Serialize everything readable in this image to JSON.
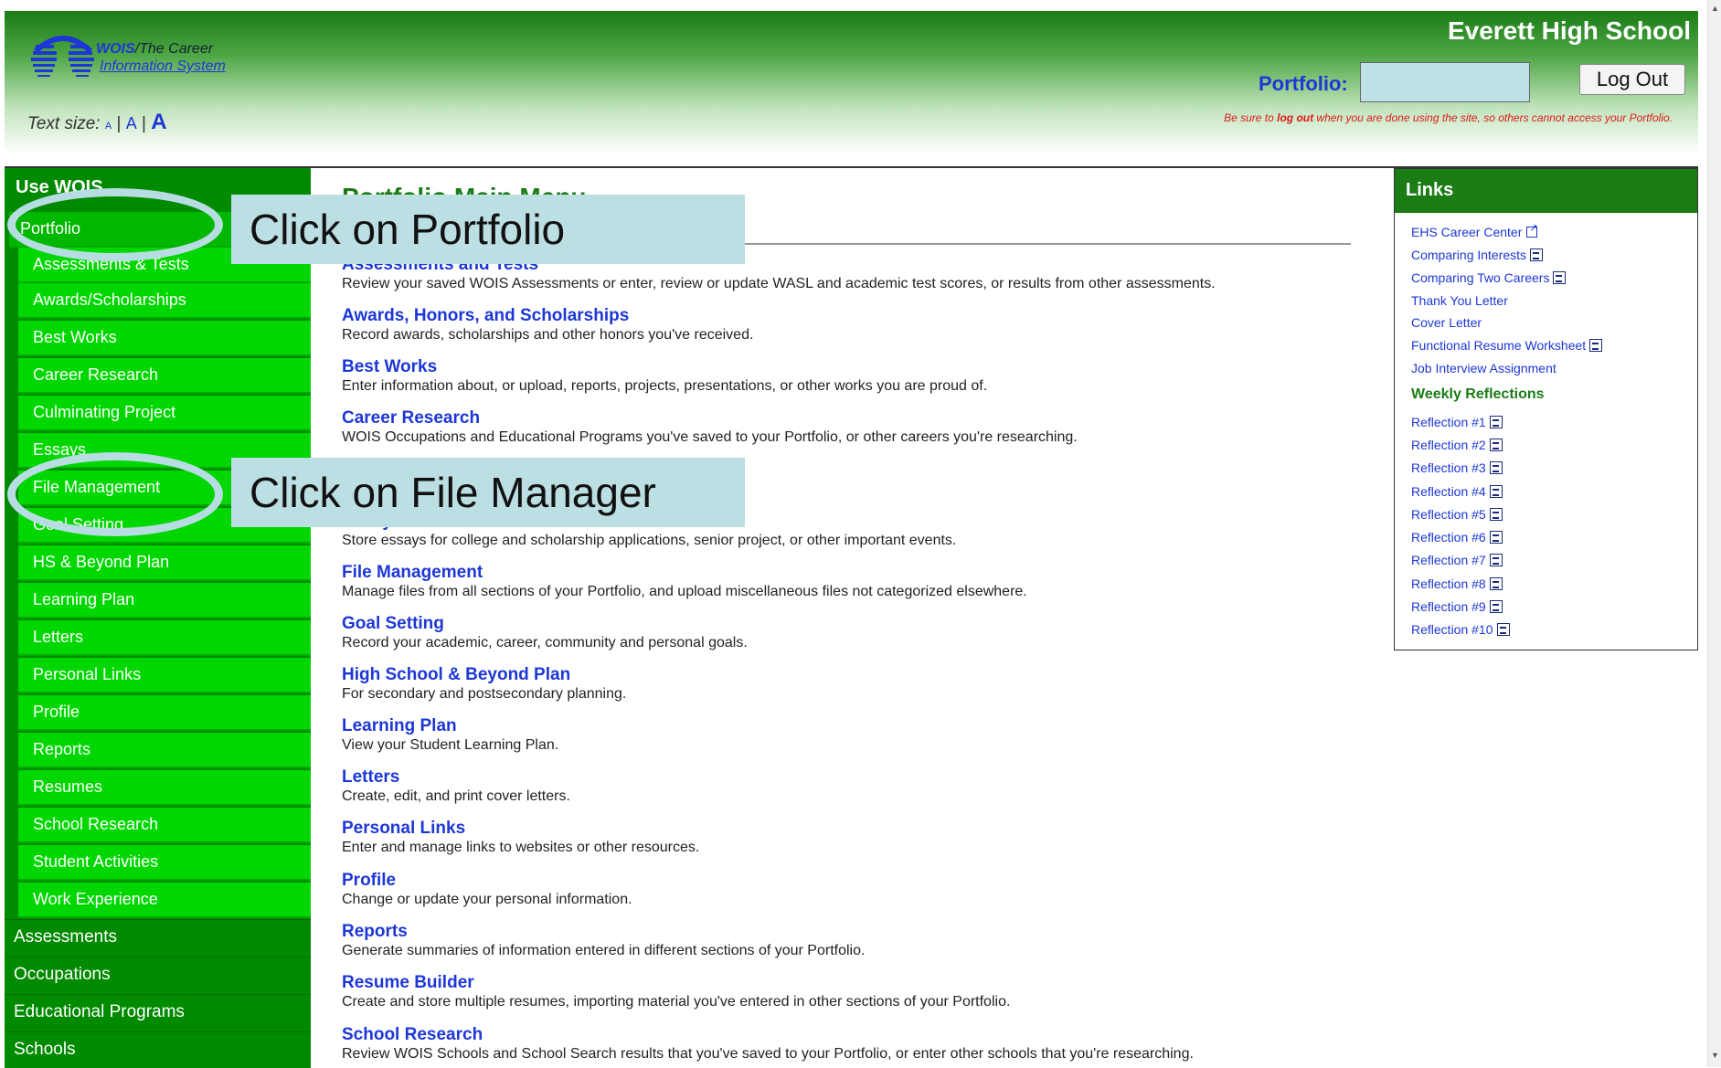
{
  "header": {
    "logo_brand": "WOIS",
    "logo_line1_rest": "/The Career",
    "logo_line2": "Information System",
    "text_size_label": "Text size:",
    "text_size_options": [
      "A",
      "A",
      "A"
    ],
    "school_name": "Everett High School",
    "portfolio_label": "Portfolio:",
    "portfolio_value": "",
    "logout_label": "Log Out",
    "warning_pre": "Be sure to ",
    "warning_bold": "log out",
    "warning_post": " when you are done using the site, so others cannot access your Portfolio."
  },
  "nav": {
    "title": "Use WOIS",
    "items": [
      {
        "label": "Portfolio"
      },
      {
        "label": "Assessments & Tests"
      },
      {
        "label": "Awards/Scholarships"
      },
      {
        "label": "Best Works"
      },
      {
        "label": "Career Research"
      },
      {
        "label": "Culminating Project"
      },
      {
        "label": "Essays"
      },
      {
        "label": "File Management"
      },
      {
        "label": "Goal Setting"
      },
      {
        "label": "HS & Beyond Plan"
      },
      {
        "label": "Learning Plan"
      },
      {
        "label": "Letters"
      },
      {
        "label": "Personal Links"
      },
      {
        "label": "Profile"
      },
      {
        "label": "Reports"
      },
      {
        "label": "Resumes"
      },
      {
        "label": "School Research"
      },
      {
        "label": "Student Activities"
      },
      {
        "label": "Work Experience"
      }
    ],
    "categories": [
      {
        "label": "Assessments"
      },
      {
        "label": "Occupations"
      },
      {
        "label": "Educational Programs"
      },
      {
        "label": "Schools"
      }
    ]
  },
  "main": {
    "title": "Portfolio Main Menu",
    "items": [
      {
        "title": "Assessments and Tests",
        "desc": "Review your saved WOIS Assessments or enter, review or update WASL and academic test scores, or results from other assessments."
      },
      {
        "title": "Awards, Honors, and Scholarships",
        "desc": "Record awards, scholarships and other honors you've received."
      },
      {
        "title": "Best Works",
        "desc": "Enter information about, or upload, reports, projects, presentations, or other works you are proud of."
      },
      {
        "title": "Career Research",
        "desc": "WOIS Occupations and Educational Programs you've saved to your Portfolio, or other careers you're researching."
      },
      {
        "title": "Essays",
        "desc": "Store essays for college and scholarship applications, senior project, or other important events."
      },
      {
        "title": "File Management",
        "desc": "Manage files from all sections of your Portfolio, and upload miscellaneous files not categorized elsewhere."
      },
      {
        "title": "Goal Setting",
        "desc": "Record your academic, career, community and personal goals."
      },
      {
        "title": "High School & Beyond Plan",
        "desc": "For secondary and postsecondary planning."
      },
      {
        "title": "Learning Plan",
        "desc": "View your Student Learning Plan."
      },
      {
        "title": "Letters",
        "desc": "Create, edit, and print cover letters."
      },
      {
        "title": "Personal Links",
        "desc": "Enter and manage links to websites or other resources."
      },
      {
        "title": "Profile",
        "desc": "Change or update your personal information."
      },
      {
        "title": "Reports",
        "desc": "Generate summaries of information entered in different sections of your Portfolio."
      },
      {
        "title": "Resume Builder",
        "desc": "Create and store multiple resumes, importing material you've entered in other sections of your Portfolio."
      },
      {
        "title": "School Research",
        "desc": "Review WOIS Schools and School Search results that you've saved to your Portfolio, or enter other schools that you're researching."
      }
    ]
  },
  "links": {
    "title": "Links",
    "items": [
      {
        "label": "EHS Career Center",
        "icon": "external-link-icon"
      },
      {
        "label": "Comparing Interests",
        "icon": "document-icon"
      },
      {
        "label": "Comparing Two Careers",
        "icon": "document-icon"
      },
      {
        "label": "Thank You Letter",
        "icon": ""
      },
      {
        "label": "Cover Letter",
        "icon": ""
      },
      {
        "label": "Functional Resume Worksheet",
        "icon": "document-icon"
      },
      {
        "label": "Job Interview Assignment",
        "icon": ""
      }
    ],
    "weekly_title": "Weekly Reflections",
    "reflections": [
      {
        "label": "Reflection #1"
      },
      {
        "label": "Reflection #2"
      },
      {
        "label": "Reflection #3"
      },
      {
        "label": "Reflection #4"
      },
      {
        "label": "Reflection #5"
      },
      {
        "label": "Reflection #6"
      },
      {
        "label": "Reflection #7"
      },
      {
        "label": "Reflection #8"
      },
      {
        "label": "Reflection #9"
      },
      {
        "label": "Reflection #10"
      }
    ]
  },
  "callouts": [
    {
      "text": "Click on Portfolio"
    },
    {
      "text": "Click on File Manager"
    }
  ],
  "colors": {
    "header_green": "#1b7c16",
    "nav_item_green": "#00d700",
    "nav_dark_green": "#008a00",
    "link_blue": "#1d37d6",
    "callout_bg": "#bcdfe3",
    "warning_red": "#e01a1a"
  }
}
